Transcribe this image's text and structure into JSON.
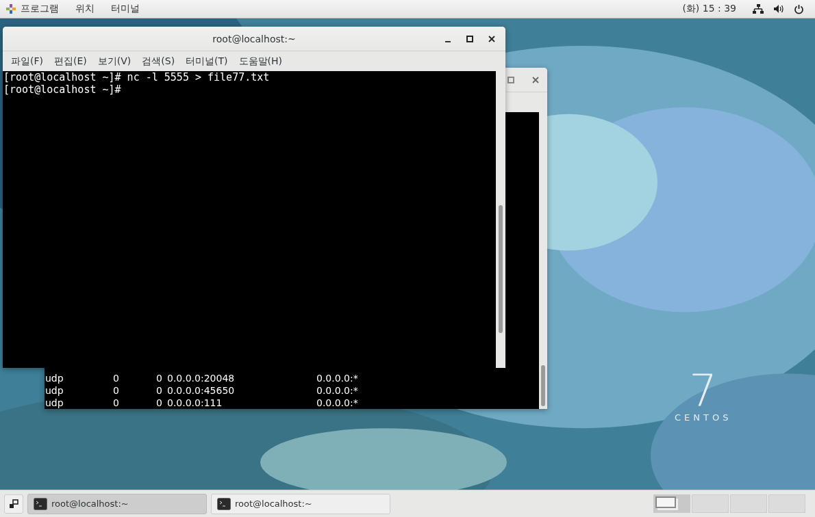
{
  "top_bar": {
    "menus": [
      "프로그램",
      "위치",
      "터미널"
    ],
    "clock": "(화) 15 : 39"
  },
  "back_window": {
    "rows": [
      [
        "udp",
        "0",
        "0",
        "0.0.0.0:20048",
        "0.0.0.0:*"
      ],
      [
        "udp",
        "0",
        "0",
        "0.0.0.0:45650",
        "0.0.0.0:*"
      ],
      [
        "udp",
        "0",
        "0",
        "0.0.0.0:111",
        "0.0.0.0:*"
      ]
    ]
  },
  "front_window": {
    "title": "root@localhost:~",
    "menu": [
      "파일(F)",
      "편집(E)",
      "보기(V)",
      "검색(S)",
      "터미널(T)",
      "도움말(H)"
    ],
    "lines": [
      "[root@localhost ~]# nc -l 5555 > file77.txt",
      "[root@localhost ~]#"
    ]
  },
  "desktop_logo": {
    "number": "7",
    "name": "CENTOS"
  },
  "taskbar": {
    "items": [
      {
        "label": "root@localhost:~",
        "selected": true
      },
      {
        "label": "root@localhost:~",
        "selected": false
      }
    ],
    "workspaces": [
      {
        "selected": true
      },
      {
        "selected": false
      },
      {
        "selected": false
      },
      {
        "selected": false
      }
    ]
  }
}
